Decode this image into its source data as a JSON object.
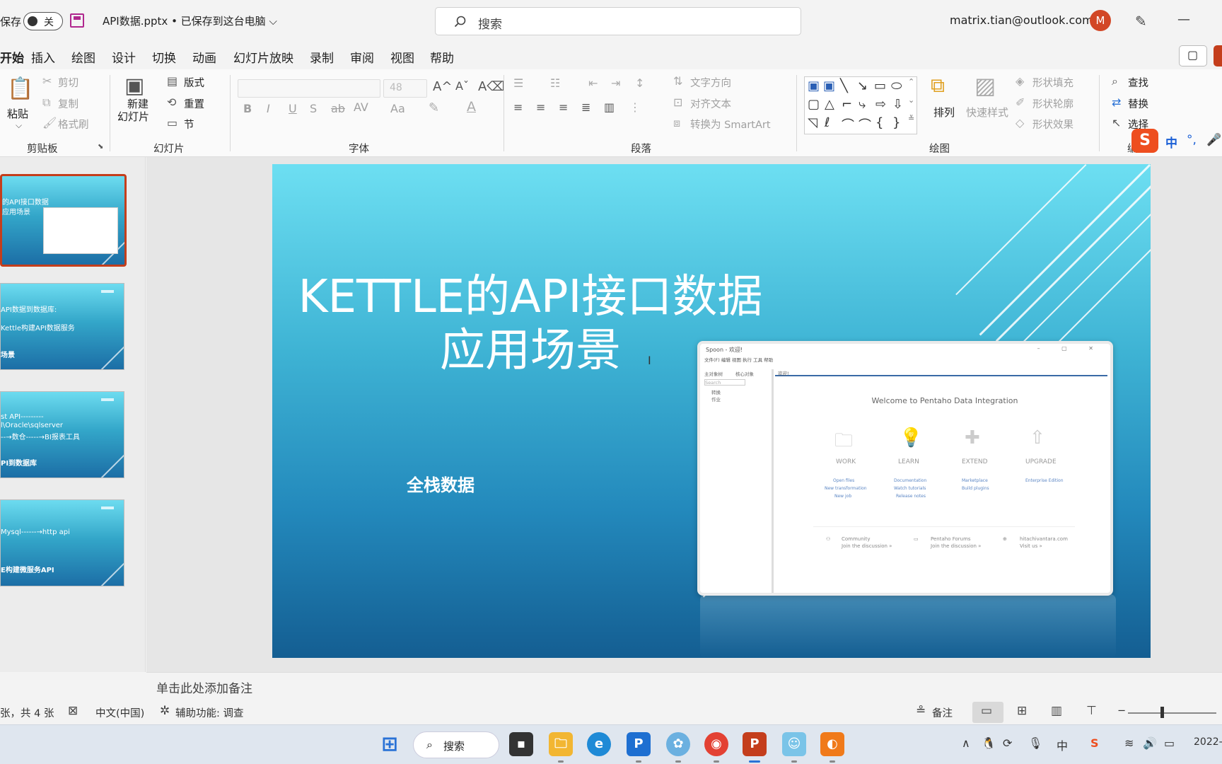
{
  "titlebar": {
    "autosave_label": "保存",
    "autosave_state": "关",
    "doc_title": "API数据.pptx • 已保存到这台电脑 ⌵",
    "search_placeholder": "搜索",
    "account": "matrix.tian@outlook.com",
    "avatar_letter": "M"
  },
  "tabs": [
    "开始",
    "插入",
    "绘图",
    "设计",
    "切换",
    "动画",
    "幻灯片放映",
    "录制",
    "审阅",
    "视图",
    "帮助"
  ],
  "ribbon": {
    "clipboard": {
      "paste": "粘贴",
      "cut": "剪切",
      "copy": "复制",
      "format_painter": "格式刷",
      "label": "剪贴板"
    },
    "slides": {
      "new_slide": "新建",
      "new_slide_line2": "幻灯片",
      "layout": "版式",
      "reset": "重置",
      "section": "节",
      "label": "幻灯片"
    },
    "font": {
      "font_size": "48",
      "label": "字体",
      "bold": "B",
      "italic": "I",
      "underline": "U",
      "shadow": "S",
      "strike": "ab",
      "spacing": "AV",
      "case": "Aa"
    },
    "paragraph": {
      "text_direction": "文字方向",
      "align_text": "对齐文本",
      "smartart": "转换为 SmartArt",
      "label": "段落"
    },
    "drawing": {
      "arrange": "排列",
      "quick_styles": "快速样式",
      "shape_fill": "形状填充",
      "shape_outline": "形状轮廓",
      "shape_effects": "形状效果",
      "label": "绘图"
    },
    "editing": {
      "find": "查找",
      "replace": "替换",
      "select": "选择",
      "label": "编"
    }
  },
  "ime": {
    "logo": "S",
    "mode": "中",
    "punct": "°,",
    "mic": "🎤"
  },
  "thumbnails": [
    {
      "lines": [
        "的API接口数据",
        "应用场景"
      ]
    },
    {
      "lines": [
        "API数据到数据库:",
        "Kettle构建API数据服务",
        "场景"
      ]
    },
    {
      "lines": [
        "st API---------",
        "l\\Oracle\\sqlserver",
        "--→数仓-----→BI报表工具",
        "PI到数据库"
      ]
    },
    {
      "lines": [
        "Mysql------→http api",
        "E构建微服务API"
      ]
    }
  ],
  "slide": {
    "title_line1": "KETTLE的API接口数据",
    "title_line2": "应用场景",
    "subtitle": "全栈数据",
    "window": {
      "title": "Spoon - 欢迎!",
      "menu": "文件(F)  编辑  视图  执行  工具  帮助",
      "tree_tab1": "主对象树",
      "tree_tab2": "核心对象",
      "search": "Search",
      "tree_item1": "转换",
      "tree_item2": "作业",
      "tab_welcome": "欢迎!",
      "welcome": "Welcome to Pentaho Data Integration",
      "tiles": [
        {
          "label": "WORK",
          "links": [
            "Open files",
            "New transformation",
            "New job"
          ]
        },
        {
          "label": "LEARN",
          "links": [
            "Documentation",
            "Watch tutorials",
            "Release notes"
          ]
        },
        {
          "label": "EXTEND",
          "links": [
            "Marketplace",
            "Build plugins"
          ]
        },
        {
          "label": "UPGRADE",
          "links": [
            "Enterprise Edition"
          ]
        }
      ],
      "footer": [
        {
          "title": "Community",
          "sub": "Join the discussion »"
        },
        {
          "title": "Pentaho Forums",
          "sub": "Join the discussion »"
        },
        {
          "title": "hitachivantara.com",
          "sub": "Visit us »"
        }
      ]
    }
  },
  "notes_placeholder": "单击此处添加备注",
  "status": {
    "slide_count": "张，共 4 张",
    "language": "中文(中国)",
    "accessibility": "辅助功能: 调查",
    "notes": "备注",
    "zoom_minus": "−"
  },
  "taskbar": {
    "search": "搜索",
    "date": "2022-"
  }
}
